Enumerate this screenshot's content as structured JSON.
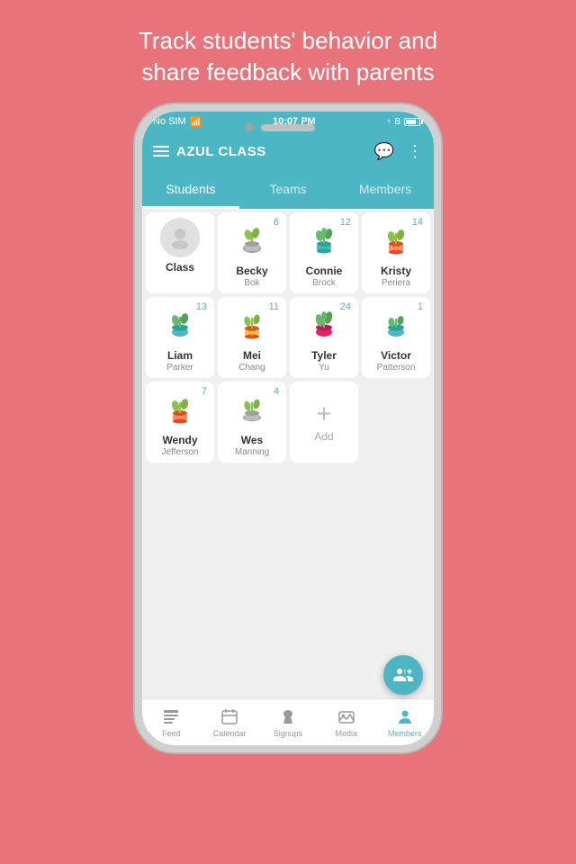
{
  "headline": "Track students' behavior and\nshare feedback with parents",
  "status_bar": {
    "left": "No SIM",
    "center": "10:07 PM",
    "right": ""
  },
  "nav": {
    "title": "AZUL CLASS"
  },
  "tabs": [
    {
      "label": "Students",
      "active": true
    },
    {
      "label": "Teams",
      "active": false
    },
    {
      "label": "Members",
      "active": false
    }
  ],
  "students": [
    {
      "name": "Class",
      "last": "",
      "score": "",
      "plant": "class",
      "is_class": true
    },
    {
      "name": "Becky",
      "last": "Bok",
      "score": "6",
      "plant": "gray"
    },
    {
      "name": "Connie",
      "last": "Brock",
      "score": "12",
      "plant": "teal"
    },
    {
      "name": "Kristy",
      "last": "Periera",
      "score": "14",
      "plant": "orange"
    },
    {
      "name": "Liam",
      "last": "Parker",
      "score": "13",
      "plant": "green"
    },
    {
      "name": "Mei",
      "last": "Chang",
      "score": "11",
      "plant": "orange2"
    },
    {
      "name": "Tyler",
      "last": "Yu",
      "score": "24",
      "plant": "pink"
    },
    {
      "name": "Victor",
      "last": "Patterson",
      "score": "1",
      "plant": "green2"
    },
    {
      "name": "Wendy",
      "last": "Jefferson",
      "score": "7",
      "plant": "orange3"
    },
    {
      "name": "Wes",
      "last": "Manning",
      "score": "4",
      "plant": "gray2"
    },
    {
      "name": "Add",
      "last": "",
      "score": "",
      "plant": "add",
      "is_add": true
    }
  ],
  "bottom_nav": [
    {
      "label": "Feed",
      "icon": "feed",
      "active": false
    },
    {
      "label": "Calendar",
      "icon": "calendar",
      "active": false
    },
    {
      "label": "Signups",
      "icon": "signups",
      "active": false
    },
    {
      "label": "Media",
      "icon": "media",
      "active": false
    },
    {
      "label": "Members",
      "icon": "members",
      "active": true
    }
  ]
}
